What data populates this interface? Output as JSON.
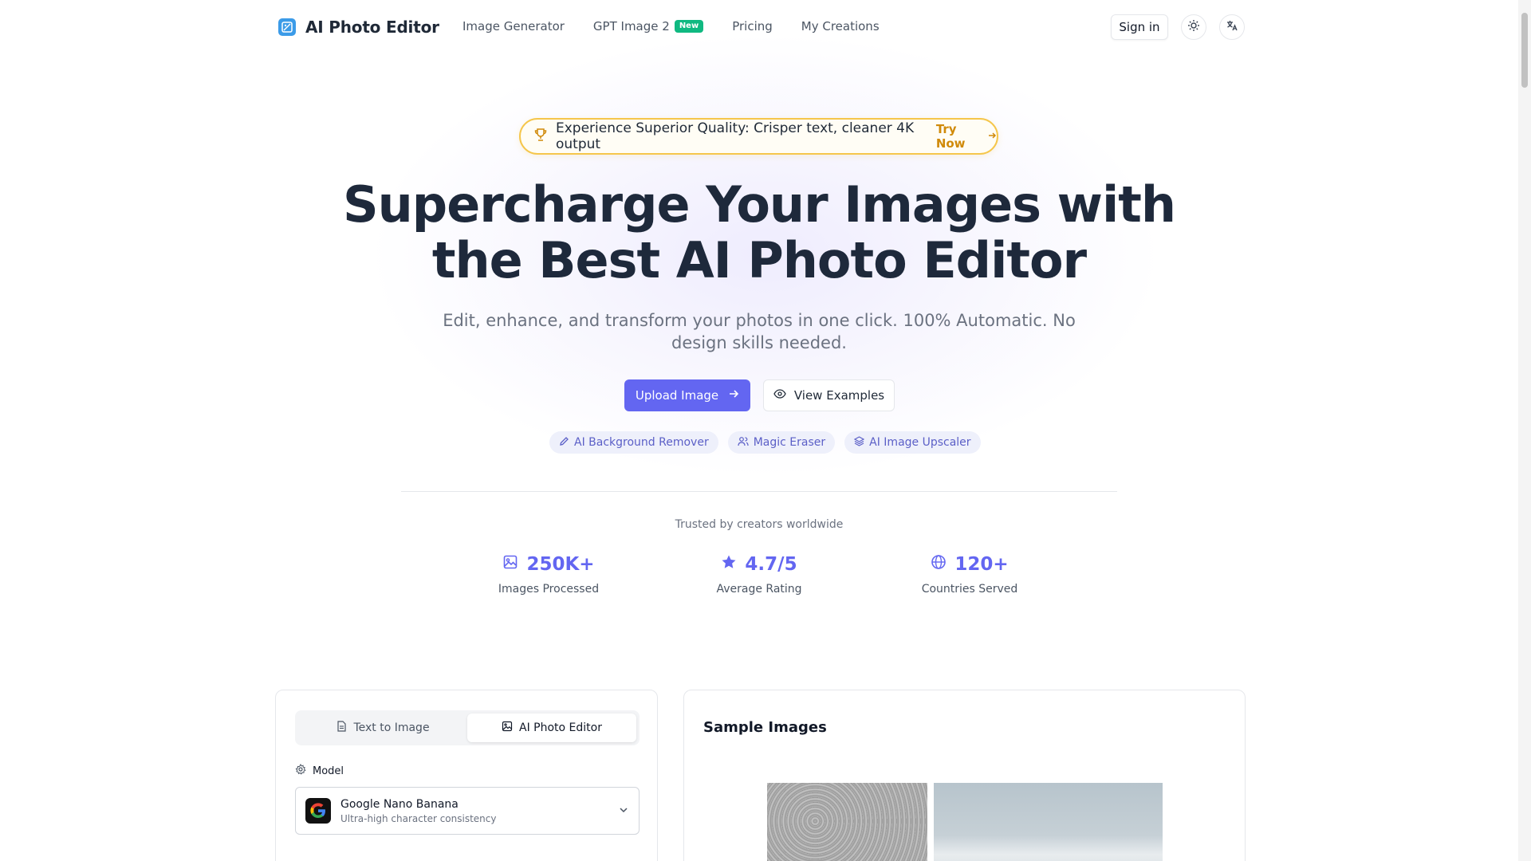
{
  "brand": {
    "name": "AI Photo Editor"
  },
  "nav": {
    "links": [
      {
        "label": "Image Generator"
      },
      {
        "label": "GPT Image 2",
        "badge": "New"
      },
      {
        "label": "Pricing"
      },
      {
        "label": "My Creations"
      }
    ],
    "signin_label": "Sign in"
  },
  "hero": {
    "promo_text": "Experience Superior Quality: Crisper text, cleaner 4K output",
    "promo_cta": "Try Now",
    "title_line1": "Supercharge Your Images with",
    "title_line2": "the Best AI Photo Editor",
    "subtitle": "Edit, enhance, and transform your photos in one click. 100% Automatic. No design skills needed.",
    "primary_button": "Upload Image",
    "secondary_button": "View Examples",
    "chips": [
      "AI Background Remover",
      "Magic Eraser",
      "AI Image Upscaler"
    ]
  },
  "trust": {
    "heading": "Trusted by creators worldwide",
    "stats": [
      {
        "value": "250K+",
        "label": "Images Processed",
        "icon": "image-icon"
      },
      {
        "value": "4.7/5",
        "label": "Average Rating",
        "icon": "star-icon"
      },
      {
        "value": "120+",
        "label": "Countries Served",
        "icon": "globe-icon"
      }
    ]
  },
  "editor": {
    "tabs": [
      {
        "label": "Text to Image",
        "active": false
      },
      {
        "label": "AI Photo Editor",
        "active": true
      }
    ],
    "model_label": "Model",
    "model_name": "Google Nano Banana",
    "model_desc": "Ultra-high character consistency"
  },
  "samples": {
    "title": "Sample Images"
  },
  "colors": {
    "accent": "#6366f1",
    "promo_border": "#f5c64b",
    "badge": "#10b981"
  }
}
